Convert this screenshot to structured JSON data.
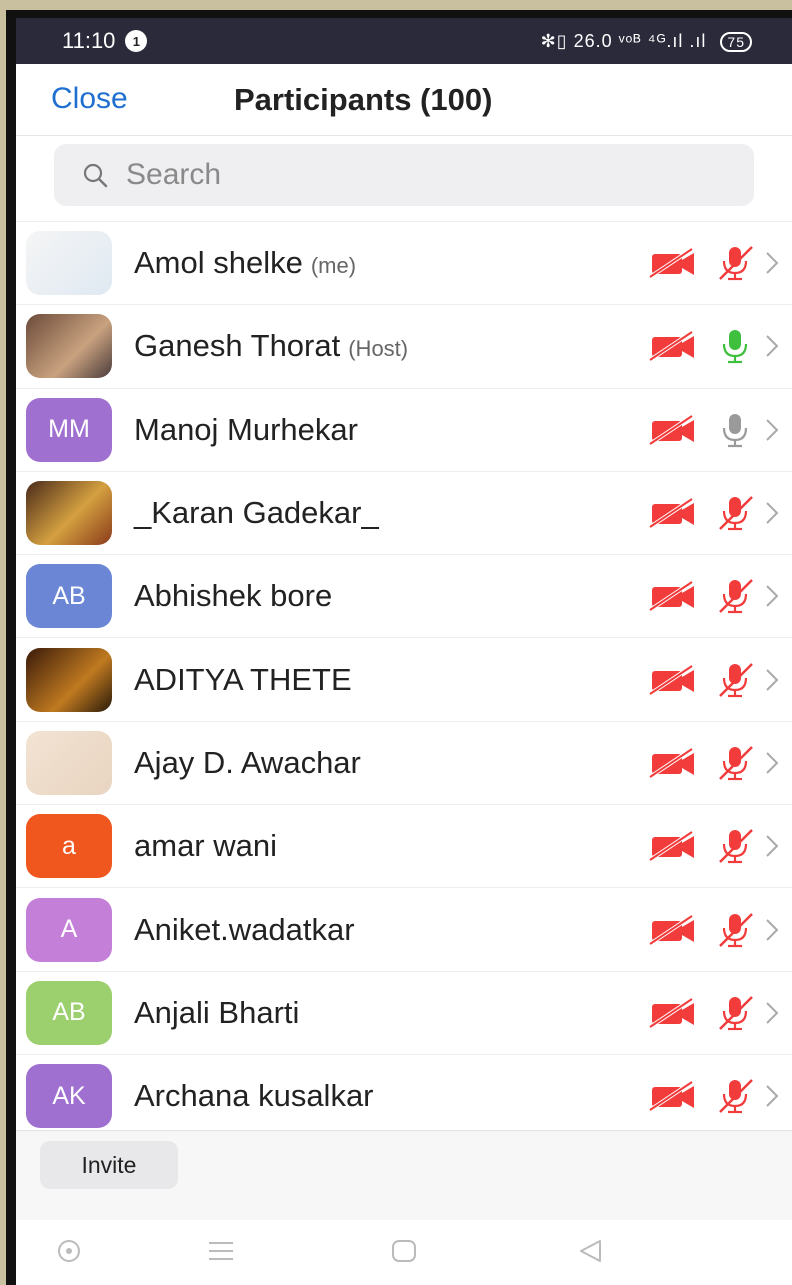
{
  "status_bar": {
    "time": "11:10",
    "notification_count": "1",
    "right_icons": "✻▯ 26.0 ᵛᵒᴮ ⁴ᴳ.ıl .ıl",
    "battery": "75"
  },
  "header": {
    "close_label": "Close",
    "title": "Participants (100)"
  },
  "search": {
    "placeholder": "Search"
  },
  "participants": [
    {
      "name": "Amol shelke",
      "tag": "(me)",
      "avatar": "image",
      "video": "off",
      "mic": "muted"
    },
    {
      "name": "Ganesh Thorat",
      "tag": "(Host)",
      "avatar": "photo",
      "video": "off",
      "mic": "active"
    },
    {
      "name": "Manoj Murhekar",
      "tag": "",
      "avatar": "MM",
      "avatar_color": "#a070d0",
      "video": "off",
      "mic": "idle"
    },
    {
      "name": "_Karan Gadekar_",
      "tag": "",
      "avatar": "photo",
      "video": "off",
      "mic": "muted"
    },
    {
      "name": "Abhishek bore",
      "tag": "",
      "avatar": "AB",
      "avatar_color": "#6a86d4",
      "video": "off",
      "mic": "muted"
    },
    {
      "name": "ADITYA THETE",
      "tag": "",
      "avatar": "photo",
      "video": "off",
      "mic": "muted"
    },
    {
      "name": "Ajay D. Awachar",
      "tag": "",
      "avatar": "image",
      "video": "off",
      "mic": "muted"
    },
    {
      "name": "amar wani",
      "tag": "",
      "avatar": "a",
      "avatar_color": "#f0571e",
      "video": "off",
      "mic": "muted"
    },
    {
      "name": "Aniket.wadatkar",
      "tag": "",
      "avatar": "A",
      "avatar_color": "#c47fd8",
      "video": "off",
      "mic": "muted"
    },
    {
      "name": "Anjali Bharti",
      "tag": "",
      "avatar": "AB",
      "avatar_color": "#9ccf6e",
      "video": "off",
      "mic": "muted"
    },
    {
      "name": "Archana kusalkar",
      "tag": "",
      "avatar": "AK",
      "avatar_color": "#a070d0",
      "video": "off",
      "mic": "muted"
    }
  ],
  "footer": {
    "invite_label": "Invite"
  },
  "colors": {
    "accent": "#1f6fd1",
    "muted_red": "#f23b3b",
    "active_green": "#3ec03e",
    "idle_gray": "#9a9a9a"
  }
}
